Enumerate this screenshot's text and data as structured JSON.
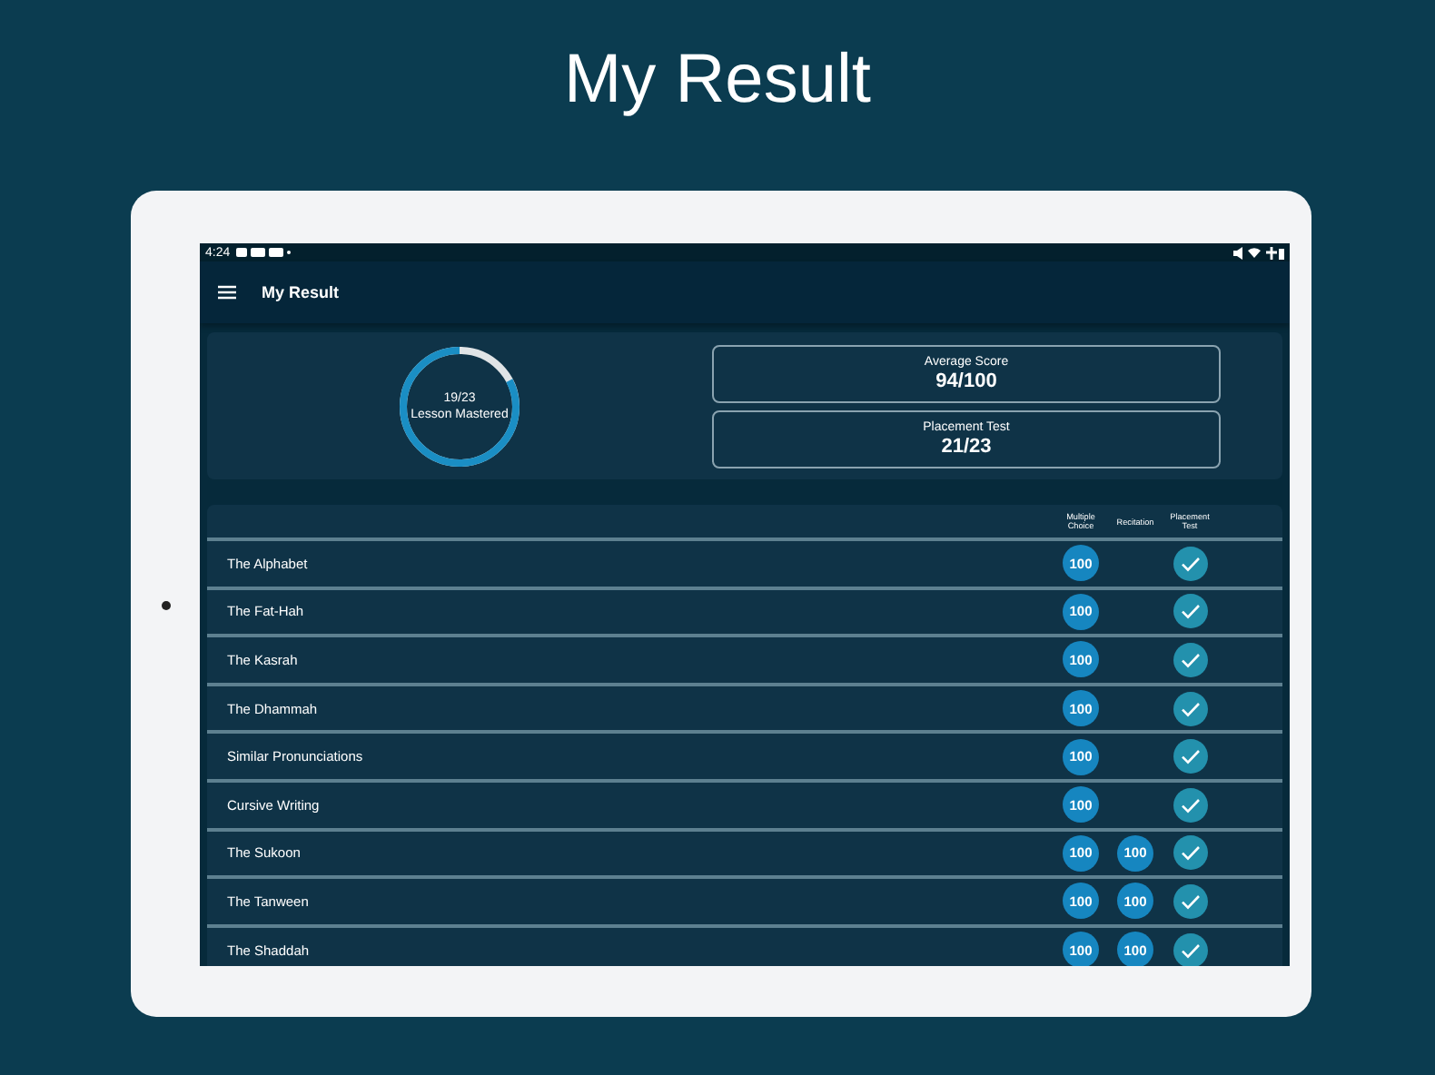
{
  "headline": "My Result",
  "status_bar": {
    "time": "4:24"
  },
  "app_bar": {
    "title": "My Result"
  },
  "summary": {
    "progress": {
      "count": "19/23",
      "label": "Lesson Mastered",
      "level": 0.826
    },
    "stats": [
      {
        "label": "Average Score",
        "value": "94/100"
      },
      {
        "label": "Placement Test",
        "value": "21/23"
      }
    ]
  },
  "table": {
    "columns": [
      "Multiple Choice",
      "Recitation",
      "Placement Test"
    ],
    "rows": [
      {
        "name": "The Alphabet",
        "multiple_choice": "100",
        "placement_passed": true
      },
      {
        "name": "The Fat-Hah",
        "multiple_choice": "100",
        "placement_passed": true
      },
      {
        "name": "The Kasrah",
        "multiple_choice": "100",
        "placement_passed": true
      },
      {
        "name": "The Dhammah",
        "multiple_choice": "100",
        "placement_passed": true
      },
      {
        "name": "Similar Pronunciations",
        "multiple_choice": "100",
        "placement_passed": true
      },
      {
        "name": "Cursive Writing",
        "multiple_choice": "100",
        "placement_passed": true
      },
      {
        "name": "The Sukoon",
        "multiple_choice": "100",
        "recitation": "100",
        "placement_passed": true
      },
      {
        "name": "The Tanween",
        "multiple_choice": "100",
        "recitation": "100",
        "placement_passed": true
      },
      {
        "name": "The Shaddah",
        "multiple_choice": "100",
        "recitation": "100",
        "placement_passed": true
      }
    ]
  }
}
